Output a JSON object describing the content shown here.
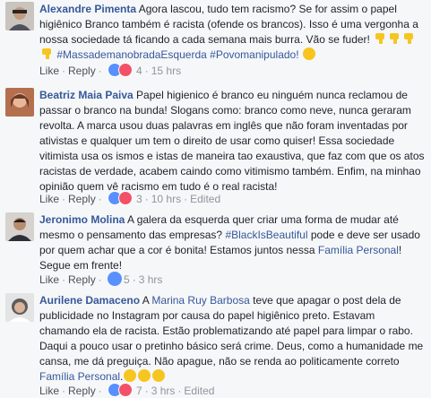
{
  "comments": [
    {
      "author": "Alexandre Pimenta",
      "text": " Agora lascou, tudo tem racismo? Se for assim o papel higiênico Branco também é racista (ofende os brancos). Isso é uma vergonha a nossa sociedade tá ficando a cada semana mais burra. Vão se fuder! ",
      "tags": [
        "#MassademanobradaEsquerda",
        "#Povomanipulado!"
      ],
      "like_label": "Like",
      "reply_label": "Reply",
      "reactions_count": "4",
      "time": "15 hrs",
      "edited": ""
    },
    {
      "author": "Beatriz Maia Paiva",
      "text": " Papel higienico é branco eu ninguém nunca reclamou de passar o branco na bunda! Slogans como: branco como neve, nunca geraram revolta. A marca usou duas palavras em inglês que não foram inventadas por ativistas e qualquer um tem o direito de usar como quiser! Essa sociedade vitimista usa os ismos e istas de maneira tao exaustiva, que faz com que os atos racistas de verdade, acabem caindo como vitimismo também. Enfim, na minhao opinião quem vê racismo em tudo é o real racista!",
      "like_label": "Like",
      "reply_label": "Reply",
      "reactions_count": "3",
      "time": "10 hrs",
      "edited": "Edited"
    },
    {
      "author": "Jeronimo Molina",
      "text_before": " A galera da esquerda quer criar uma forma de mudar até mesmo o pensamento das empresas? ",
      "tag": "#BlackIsBeautiful",
      "text_middle": " pode e deve ser usado por quem achar que a cor é bonita! Estamos juntos nessa ",
      "mention": "Família Personal",
      "text_after": "! Segue em frente!",
      "like_label": "Like",
      "reply_label": "Reply",
      "reactions_count": "5",
      "time": "3 hrs",
      "edited": ""
    },
    {
      "author": "Aurilene Damaceno",
      "text_before": " A ",
      "mention1": "Marina Ruy Barbosa",
      "text_middle": " teve que apagar o post dela de publicidade no Instagram por causa do papel higiênico preto. Estavam chamando ela de racista. Estão problematizando até papel para limpar o rabo. Daqui a pouco usar o pretinho básico será crime. Deus, como a humanidade me cansa, me dá preguiça. Não apague, não se renda ao politicamente correto ",
      "mention2": "Família Personal",
      "text_after": ".",
      "like_label": "Like",
      "reply_label": "Reply",
      "reactions_count": "7",
      "time": "3 hrs",
      "edited": "Edited"
    }
  ],
  "colors": {
    "link": "#365899",
    "meta": "#90949c",
    "like": "#5890ff",
    "love": "#f25268",
    "emoji": "#f7c520"
  }
}
